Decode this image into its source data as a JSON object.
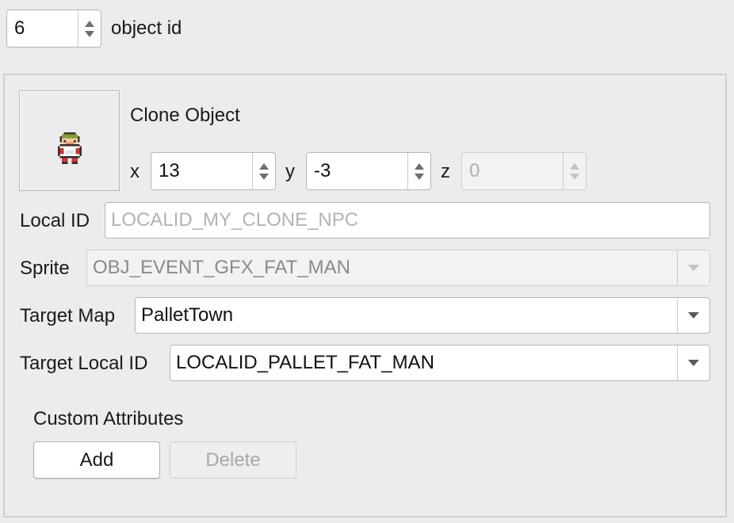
{
  "top": {
    "object_id_value": "6",
    "object_id_label": "object id"
  },
  "object": {
    "title": "Clone Object",
    "sprite_icon": "npc-fat-man-sprite",
    "x_label": "x",
    "x_value": "13",
    "y_label": "y",
    "y_value": "-3",
    "z_label": "z",
    "z_value": "0"
  },
  "fields": {
    "local_id_label": "Local ID",
    "local_id_placeholder": "LOCALID_MY_CLONE_NPC",
    "sprite_label": "Sprite",
    "sprite_value": "OBJ_EVENT_GFX_FAT_MAN",
    "target_map_label": "Target Map",
    "target_map_value": "PalletTown",
    "target_local_id_label": "Target Local ID",
    "target_local_id_value": "LOCALID_PALLET_FAT_MAN"
  },
  "custom_attributes": {
    "heading": "Custom Attributes",
    "add_label": "Add",
    "delete_label": "Delete"
  },
  "colors": {
    "background": "#ececec",
    "field_background": "#ffffff",
    "border": "#b5b5b5",
    "disabled_text": "#a8a8a8"
  }
}
